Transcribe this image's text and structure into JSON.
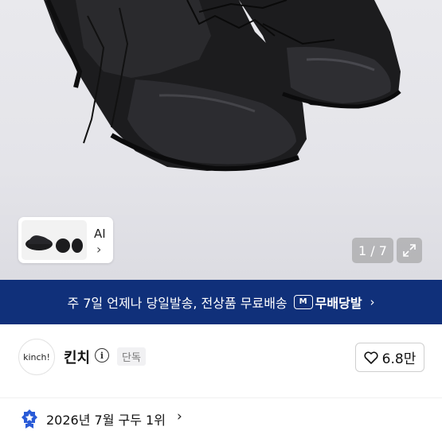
{
  "gallery": {
    "image_alt": "black leather derby shoes",
    "thumbnail_label": "AI",
    "thumbnail_chevron": "›",
    "page_counter": "1 / 7",
    "expand_icon": "expand-icon"
  },
  "promo_banner": {
    "text": "주 7일 언제나 당일발송, 전상품 무료배송",
    "badge_icon_text": "M",
    "badge_label": "무배당발",
    "chevron": "›",
    "background_color": "#10307a"
  },
  "seller": {
    "avatar_text": "kinch!",
    "name": "킨치",
    "info_icon_text": "i",
    "badge": "단독",
    "like_count": "6.8만"
  },
  "ranking": {
    "text": "2026년 7월 구두 1위",
    "chevron": "›",
    "icon": "rank-medal-icon",
    "icon_color": "#2a5bd7"
  }
}
